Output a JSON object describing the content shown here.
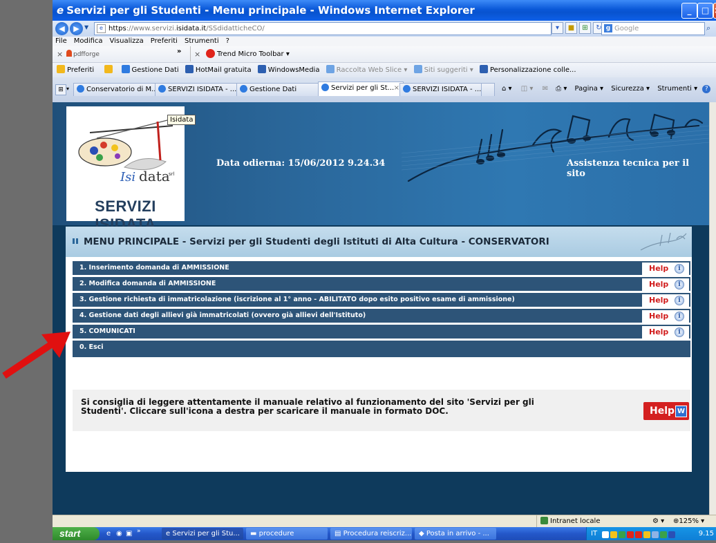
{
  "window": {
    "title": "Servizi per gli Studenti - Menu principale - Windows Internet Explorer",
    "min_label": "_",
    "max_label": "□",
    "close_label": "×"
  },
  "address": {
    "protocol": "https",
    "url_rest": "://www.servizi.",
    "url_host": "isidata.it",
    "url_path": "/SSdidatticheCO/",
    "search_placeholder": "Google"
  },
  "menubar": [
    "File",
    "Modifica",
    "Visualizza",
    "Preferiti",
    "Strumenti",
    "?"
  ],
  "toolbar": {
    "pdfforge": "pdfforge",
    "trend_micro": "Trend Micro Toolbar ▾"
  },
  "favorites": {
    "label": "Preferiti",
    "items": [
      "Gestione Dati",
      "HotMail gratuita",
      "WindowsMedia",
      "Raccolta Web Slice ▾",
      "Siti suggeriti ▾",
      "Personalizzazione colle..."
    ]
  },
  "tabs": [
    {
      "label": "Conservatorio di M..."
    },
    {
      "label": "SERVIZI ISIDATA - ..."
    },
    {
      "label": "Gestione Dati"
    },
    {
      "label": "Servizi per gli St...",
      "active": true
    },
    {
      "label": "SERVIZI ISIDATA - ..."
    }
  ],
  "tabtools": {
    "pagina": "Pagina ▾",
    "sicurezza": "Sicurezza ▾",
    "strumenti": "Strumenti ▾"
  },
  "header": {
    "logo_tooltip": "Isidata",
    "logo_caption": "SERVIZI ISIDATA",
    "date_label": "Data odierna: 15/06/2012 9.24.34",
    "assist_link": "Assistenza tecnica per il sito"
  },
  "panel": {
    "title": "MENU PRINCIPALE - Servizi per gli Studenti degli Istituti di Alta Cultura - CONSERVATORI",
    "help_label": "Help",
    "items": [
      {
        "label": "1. Inserimento domanda di AMMISSIONE",
        "has_help": true
      },
      {
        "label": "2. Modifica domanda di AMMISSIONE",
        "has_help": true
      },
      {
        "label": "3. Gestione richiesta di immatricolazione (iscrizione al 1° anno - ABILITATO dopo esito positivo esame di ammissione)",
        "has_help": true
      },
      {
        "label": "4. Gestione dati degli allievi già immatricolati (ovvero già allievi dell'Istituto)",
        "has_help": true
      },
      {
        "label": "5. COMUNICATI",
        "has_help": true
      },
      {
        "label": "0. Esci",
        "has_help": false
      }
    ],
    "info_text": "Si consiglia di leggere attentamente il manuale relativo al funzionamento del sito 'Servizi per gli Studenti'. Cliccare sull'icona a destra per scaricare il manuale in formato DOC.",
    "help_doc_label": "Help"
  },
  "status": {
    "zone": "Intranet locale",
    "zoom": "125%"
  },
  "taskbar": {
    "start": "start",
    "items": [
      "Servizi per gli Stu...",
      "procedure",
      "Procedura reiscriz...",
      "Posta in arrivo - ..."
    ],
    "lang": "IT",
    "clock": "9.15"
  },
  "colors": {
    "menu_row": "#2d5478",
    "help_red": "#d11c1c",
    "panel_header": "#a9cbe2",
    "arrow": "#e01010"
  }
}
